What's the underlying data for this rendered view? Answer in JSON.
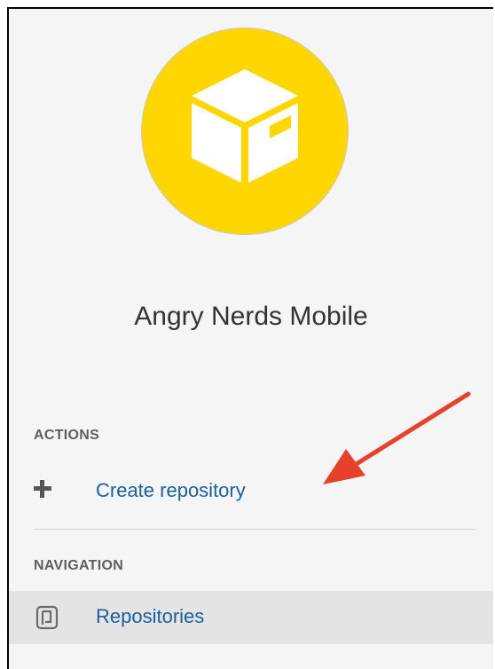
{
  "project": {
    "name": "Angry Nerds Mobile",
    "avatar_color": "#ffd600",
    "avatar_icon": "box-icon"
  },
  "sidebar": {
    "actions_heading": "ACTIONS",
    "actions": [
      {
        "label": "Create repository",
        "icon": "plus-icon"
      }
    ],
    "navigation_heading": "NAVIGATION",
    "navigation": [
      {
        "label": "Repositories",
        "icon": "repository-icon",
        "selected": true
      }
    ]
  },
  "annotation": {
    "arrow_color": "#e8402a",
    "points_to": "Create repository"
  },
  "colors": {
    "link": "#1a5f9e",
    "panel_background": "#f5f5f5",
    "selected_background": "#e4e4e4"
  }
}
